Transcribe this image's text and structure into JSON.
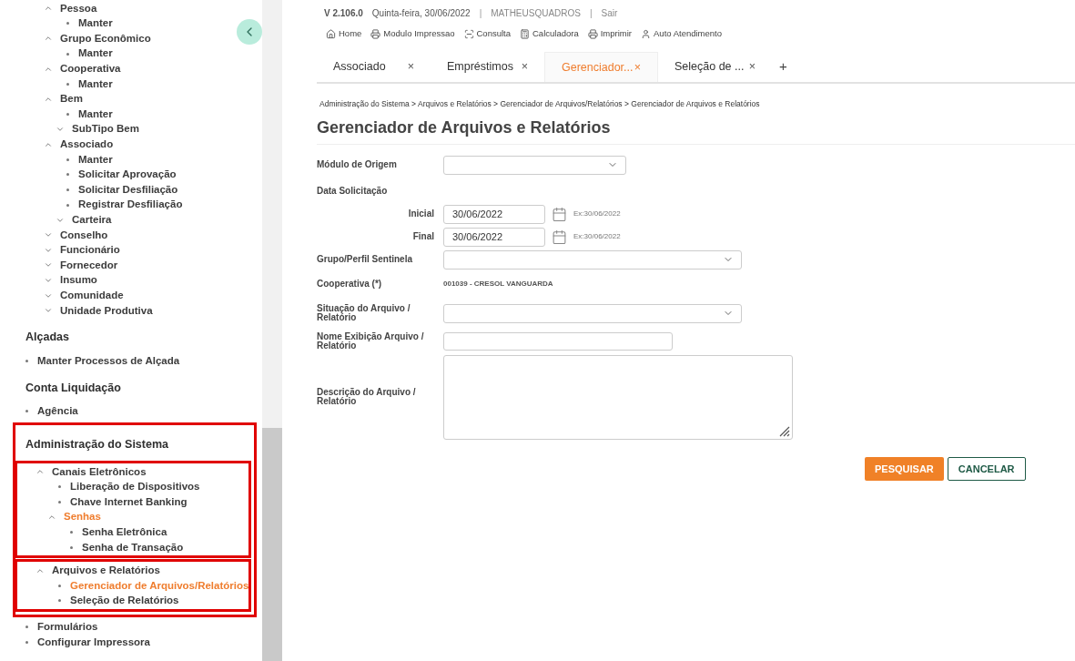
{
  "sidebar": {
    "tree": [
      {
        "kind": "group",
        "label": "Pessoa",
        "expanded": true,
        "children": [
          {
            "kind": "leaf",
            "label": "Manter"
          }
        ]
      },
      {
        "kind": "group",
        "label": "Grupo Econômico",
        "expanded": true,
        "children": [
          {
            "kind": "leaf",
            "label": "Manter"
          }
        ]
      },
      {
        "kind": "group",
        "label": "Cooperativa",
        "expanded": true,
        "children": [
          {
            "kind": "leaf",
            "label": "Manter"
          }
        ]
      },
      {
        "kind": "group",
        "label": "Bem",
        "expanded": true,
        "children": [
          {
            "kind": "leaf",
            "label": "Manter"
          },
          {
            "kind": "group",
            "label": "SubTipo Bem",
            "expanded": false
          }
        ]
      },
      {
        "kind": "group",
        "label": "Associado",
        "expanded": true,
        "children": [
          {
            "kind": "leaf",
            "label": "Manter"
          },
          {
            "kind": "leaf",
            "label": "Solicitar Aprovação"
          },
          {
            "kind": "leaf",
            "label": "Solicitar Desfiliação"
          },
          {
            "kind": "leaf",
            "label": "Registrar Desfiliação"
          },
          {
            "kind": "group",
            "label": "Carteira",
            "expanded": false
          }
        ]
      },
      {
        "kind": "group",
        "label": "Conselho",
        "expanded": false
      },
      {
        "kind": "group",
        "label": "Funcionário",
        "expanded": false
      },
      {
        "kind": "group",
        "label": "Fornecedor",
        "expanded": false
      },
      {
        "kind": "group",
        "label": "Insumo",
        "expanded": false
      },
      {
        "kind": "group",
        "label": "Comunidade",
        "expanded": false
      },
      {
        "kind": "group",
        "label": "Unidade Produtiva",
        "expanded": false
      }
    ],
    "sections": [
      {
        "title": "Alçadas",
        "highlighted": false,
        "items": [
          {
            "kind": "leaf",
            "label": "Manter Processos de Alçada"
          }
        ]
      },
      {
        "title": "Conta Liquidação",
        "highlighted": false,
        "items": [
          {
            "kind": "leaf",
            "label": "Agência"
          }
        ]
      },
      {
        "title": "Administração do Sistema",
        "highlighted": true,
        "items": [
          {
            "kind": "group",
            "label": "Canais Eletrônicos",
            "expanded": true,
            "highlighted": true,
            "children": [
              {
                "kind": "leaf",
                "label": "Liberação de Dispositivos",
                "selected": false
              },
              {
                "kind": "leaf",
                "label": "Chave Internet Banking",
                "selected": false
              },
              {
                "kind": "group",
                "label": "Senhas",
                "expanded": true,
                "selected": true,
                "children": [
                  {
                    "kind": "leaf",
                    "label": "Senha Eletrônica",
                    "selected": false
                  },
                  {
                    "kind": "leaf",
                    "label": "Senha de Transação",
                    "selected": false
                  }
                ]
              }
            ]
          },
          {
            "kind": "group",
            "label": "Arquivos e Relatórios",
            "expanded": true,
            "highlighted": true,
            "children": [
              {
                "kind": "leaf",
                "label": "Gerenciador de Arquivos/Relatórios",
                "selected": true
              },
              {
                "kind": "leaf",
                "label": "Seleção de Relatórios",
                "selected": false
              }
            ]
          }
        ]
      },
      {
        "highlighted": false,
        "items": [
          {
            "kind": "leaf",
            "label": "Formulários"
          },
          {
            "kind": "leaf",
            "label": "Configurar Impressora"
          }
        ]
      }
    ]
  },
  "header": {
    "version": "V 2.106.0",
    "date": "Quinta-feira, 30/06/2022",
    "user": "MATHEUSQUADROS",
    "logout": "Sair",
    "separator": "|"
  },
  "toolbar": [
    {
      "kind": "home",
      "label": "Home"
    },
    {
      "kind": "print",
      "label": "Modulo Impressao"
    },
    {
      "kind": "scan",
      "label": "Consulta"
    },
    {
      "kind": "calculator",
      "label": "Calculadora"
    },
    {
      "kind": "print",
      "label": "Imprimir"
    },
    {
      "kind": "user",
      "label": "Auto Atendimento"
    }
  ],
  "tabs": [
    {
      "label": "Associado",
      "close": "×",
      "selected": false
    },
    {
      "label": "Empréstimos",
      "close": "×",
      "selected": false
    },
    {
      "label": "Gerenciador...",
      "close": "×",
      "selected": true
    },
    {
      "label": "Seleção de ...",
      "close": "×",
      "selected": false
    }
  ],
  "add_tab": "+",
  "breadcrumb": "Administração do Sistema > Arquivos e Relatórios > Gerenciador de Arquivos/Relatórios > Gerenciador de Arquivos e Relatórios",
  "title": "Gerenciador de Arquivos e Relatórios",
  "form": [
    {
      "kind": "select",
      "label": "Módulo de Origem"
    },
    {
      "kind": "heading",
      "label": "Data Solicitação"
    },
    {
      "kind": "date",
      "label": "Inicial",
      "value": "30/06/2022",
      "hint": "Ex:30/06/2022"
    },
    {
      "kind": "date",
      "label": "Final",
      "value": "30/06/2022",
      "hint": "Ex:30/06/2022"
    },
    {
      "kind": "select",
      "label": "Grupo/Perfil Sentinela"
    },
    {
      "kind": "readonly",
      "label": "Cooperativa (*)",
      "value": "001039 - CRESOL VANGUARDA"
    },
    {
      "kind": "select",
      "label": "Situação do Arquivo / Relatório"
    },
    {
      "kind": "text",
      "label": "Nome Exibição Arquivo / Relatório"
    },
    {
      "kind": "textarea",
      "label": "Descrição do Arquivo / Relatório"
    }
  ],
  "buttons": [
    {
      "kind": "primary",
      "label": "PESQUISAR"
    },
    {
      "kind": "secondary",
      "label": "CANCELAR"
    }
  ]
}
